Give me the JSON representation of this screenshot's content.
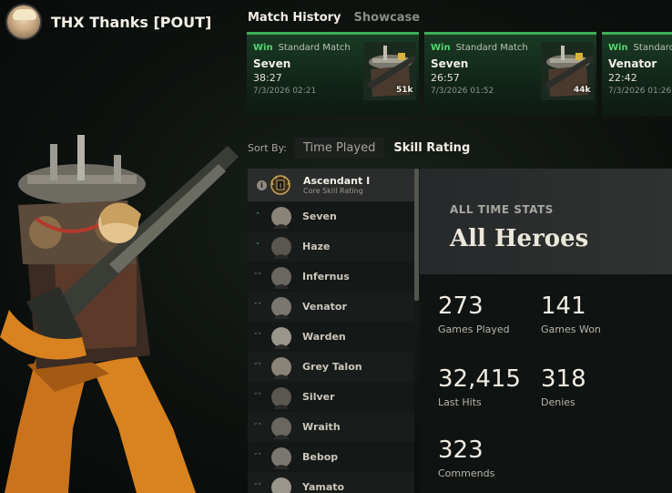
{
  "profile": {
    "username": "THX Thanks [POUT]"
  },
  "tabs": [
    {
      "label": "Match History",
      "active": true
    },
    {
      "label": "Showcase",
      "active": false
    }
  ],
  "matches": [
    {
      "result": "Win",
      "mode": "Standard Match",
      "hero": "Seven",
      "duration": "38:27",
      "date": "7/3/2026 02:21",
      "souls": "51k"
    },
    {
      "result": "Win",
      "mode": "Standard Match",
      "hero": "Seven",
      "duration": "26:57",
      "date": "7/3/2026 01:52",
      "souls": "44k"
    },
    {
      "result": "Win",
      "mode": "Standard Match",
      "hero": "Venator",
      "duration": "22:42",
      "date": "7/3/2026 01:26",
      "souls": ""
    }
  ],
  "sort": {
    "label": "Sort By:",
    "options": [
      {
        "label": "Time Played",
        "active": false
      },
      {
        "label": "Skill Rating",
        "active": true
      }
    ]
  },
  "rank": {
    "name": "Ascendant I",
    "subtitle": "Core Skill Rating",
    "badge_numeral": "I",
    "info_glyph": "i"
  },
  "heroes": [
    {
      "name": "Seven",
      "trend": "up"
    },
    {
      "name": "Haze",
      "trend": "up"
    },
    {
      "name": "Infernus",
      "trend": "down"
    },
    {
      "name": "Venator",
      "trend": "down"
    },
    {
      "name": "Warden",
      "trend": "down"
    },
    {
      "name": "Grey Talon",
      "trend": "down"
    },
    {
      "name": "Silver",
      "trend": "down"
    },
    {
      "name": "Wraith",
      "trend": "down"
    },
    {
      "name": "Bebop",
      "trend": "down"
    },
    {
      "name": "Yamato",
      "trend": "down"
    }
  ],
  "stats": {
    "kicker": "ALL TIME STATS",
    "title": "All Heroes",
    "items": [
      {
        "value": "273",
        "label": "Games Played"
      },
      {
        "value": "141",
        "label": "Games Won"
      },
      {
        "value": "32,415",
        "label": "Last Hits"
      },
      {
        "value": "318",
        "label": "Denies"
      },
      {
        "value": "323",
        "label": "Commends"
      }
    ]
  },
  "colors": {
    "win": "#52d86d",
    "card_bar": "#3fae58",
    "accent_gold": "#c9a45a"
  }
}
